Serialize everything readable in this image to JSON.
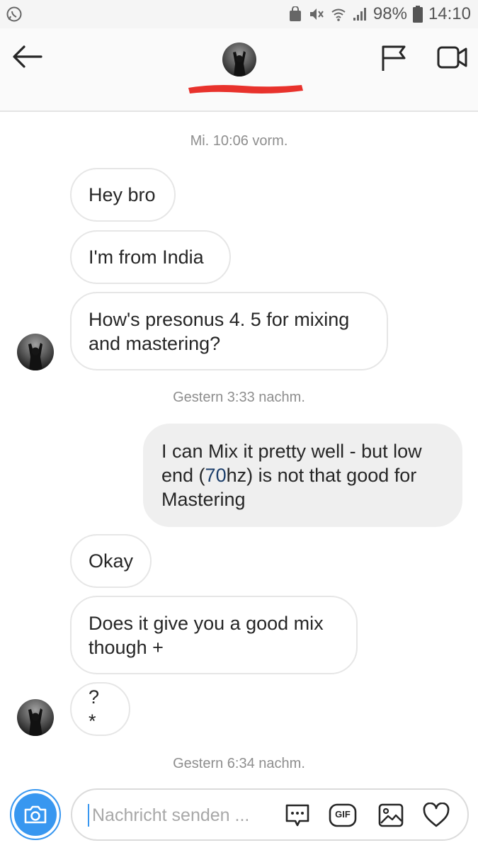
{
  "status_bar": {
    "battery": "98%",
    "time": "14:10"
  },
  "header": {
    "icons": [
      "back-arrow-icon",
      "flag-icon",
      "video-camera-icon"
    ]
  },
  "conversation": {
    "timestamps": [
      "Mi. 10:06 vorm.",
      "Gestern 3:33 nachm.",
      "Gestern 6:34 nachm."
    ],
    "messages": [
      {
        "direction": "incoming",
        "text": "Hey bro"
      },
      {
        "direction": "incoming",
        "text": "I'm from India"
      },
      {
        "direction": "incoming",
        "lines": [
          "How's presonus 4. 5 for mixing",
          "and mastering?"
        ]
      },
      {
        "direction": "outgoing",
        "line1": "I can Mix it pretty well - but low",
        "line2_pre": "end (",
        "line2_link": "70",
        "line2_post": "hz) is not that good for",
        "line3": "Mastering"
      },
      {
        "direction": "incoming",
        "text": "Okay"
      },
      {
        "direction": "incoming",
        "lines": [
          "Does it give you a good mix",
          "though +"
        ]
      },
      {
        "direction": "incoming",
        "text": "? *"
      }
    ]
  },
  "composer": {
    "placeholder": "Nachricht senden ...",
    "gif_label": "GIF",
    "icons": [
      "camera-icon",
      "more-options-icon",
      "gif-icon",
      "gallery-icon",
      "heart-icon"
    ]
  },
  "colors": {
    "accent": "#3897f0",
    "outgoing_bubble": "#efefef",
    "bubble_border": "#e6e6e6",
    "timestamp": "#8e8e8e",
    "link": "#1b3e6b",
    "redaction": "#e8322c"
  }
}
